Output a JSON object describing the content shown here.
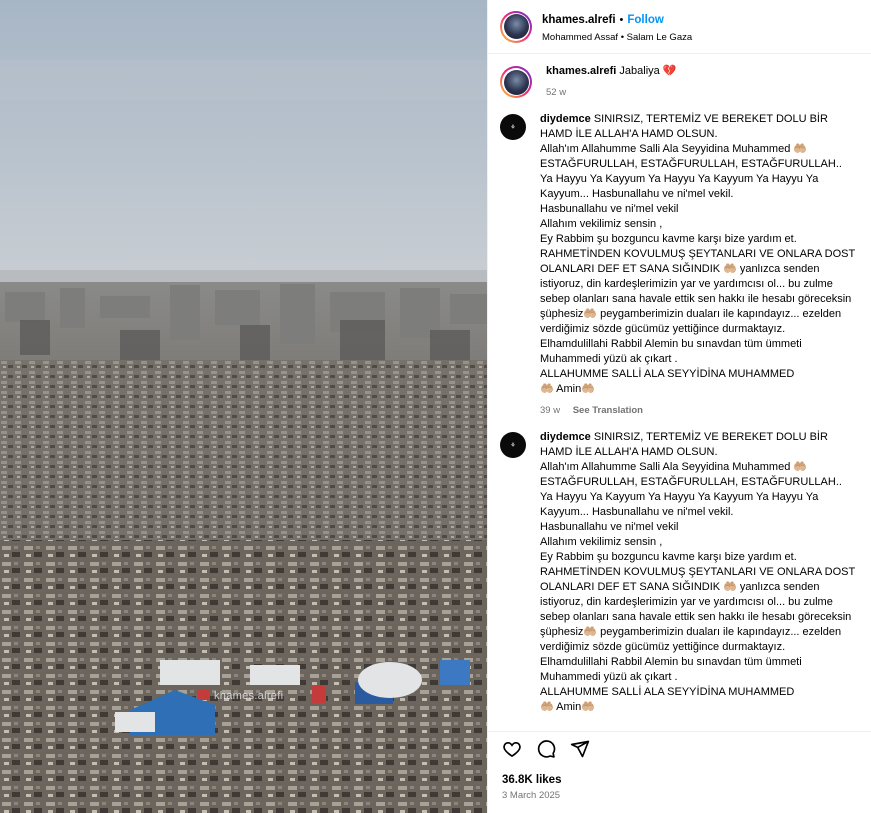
{
  "post": {
    "username": "khames.alrefi",
    "follow_label": "Follow",
    "audio_artist": "Mohammed Assaf",
    "audio_title": "Salam Le Gaza",
    "watermark": "khames.alrefi"
  },
  "caption": {
    "username": "khames.alrefi",
    "text": "Jabaliya 💔",
    "time": "52 w"
  },
  "comments": [
    {
      "username": "diydemce",
      "lines": [
        "SINIRSIZ, TERTEMİZ VE BEREKET DOLU BİR HAMD İLE ALLAH'A HAMD OLSUN.",
        "Allah'ım Allahumme Salli Ala Seyyidina Muhammed 🤲🏼 ESTAĞFURULLAH, ESTAĞFURULLAH, ESTAĞFURULLAH..",
        "Ya Hayyu Ya Kayyum Ya Hayyu Ya Kayyum Ya Hayyu Ya Kayyum... Hasbunallahu ve ni'mel vekil.",
        "Hasbunallahu ve ni'mel vekil",
        "Allahım vekilimiz sensin ,",
        "Ey Rabbim şu bozguncu kavme karşı bize yardım et.",
        "RAHMETİNDEN KOVULMUŞ ŞEYTANLARI VE ONLARA DOST OLANLARI DEF ET SANA SIĞINDIK 🤲🏼 yanlızca senden istiyoruz, din kardeşlerimizin yar ve yardımcısı ol... bu zulme sebep olanları sana havale ettik sen hakkı ile hesabı göreceksin şüphesiz🤲🏼 peygamberimizin duaları ile kapındayız... ezelden verdiğimiz sözde gücümüz yettiğince durmaktayız.",
        "Elhamdulillahi Rabbil Alemin bu sınavdan tüm ümmeti Muhammedi yüzü ak çıkart .",
        "ALLAHUMME SALLİ ALA SEYYİDİNA MUHAMMED",
        "🤲🏼 Amin🤲🏼"
      ],
      "time": "39 w",
      "see_translation": "See Translation"
    },
    {
      "username": "diydemce",
      "lines": [
        "SINIRSIZ, TERTEMİZ VE BEREKET DOLU BİR HAMD İLE ALLAH'A HAMD OLSUN.",
        "Allah'ım Allahumme Salli Ala Seyyidina Muhammed 🤲🏼 ESTAĞFURULLAH, ESTAĞFURULLAH, ESTAĞFURULLAH..",
        "Ya Hayyu Ya Kayyum Ya Hayyu Ya Kayyum Ya Hayyu Ya Kayyum... Hasbunallahu ve ni'mel vekil.",
        "Hasbunallahu ve ni'mel vekil",
        "Allahım vekilimiz sensin ,",
        "Ey Rabbim şu bozguncu kavme karşı bize yardım et.",
        "RAHMETİNDEN KOVULMUŞ ŞEYTANLARI VE ONLARA DOST OLANLARI DEF ET SANA SIĞINDIK 🤲🏼 yanlızca senden istiyoruz, din kardeşlerimizin yar ve yardımcısı ol... bu zulme sebep olanları sana havale ettik sen hakkı ile hesabı göreceksin şüphesiz🤲🏼 peygamberimizin duaları ile kapındayız... ezelden verdiğimiz sözde gücümüz yettiğince durmaktayız.",
        "Elhamdulillahi Rabbil Alemin bu sınavdan tüm ümmeti Muhammedi yüzü ak çıkart .",
        "ALLAHUMME SALLİ ALA SEYYİDİNA MUHAMMED",
        "🤲🏼 Amin🤲🏼"
      ]
    }
  ],
  "footer": {
    "likes": "36.8K likes",
    "date": "3 March 2025"
  },
  "icons": [
    "heart-icon",
    "comment-icon",
    "share-icon"
  ],
  "colors": {
    "follow": "#0095f6",
    "muted": "#737373",
    "border": "#efefef"
  }
}
